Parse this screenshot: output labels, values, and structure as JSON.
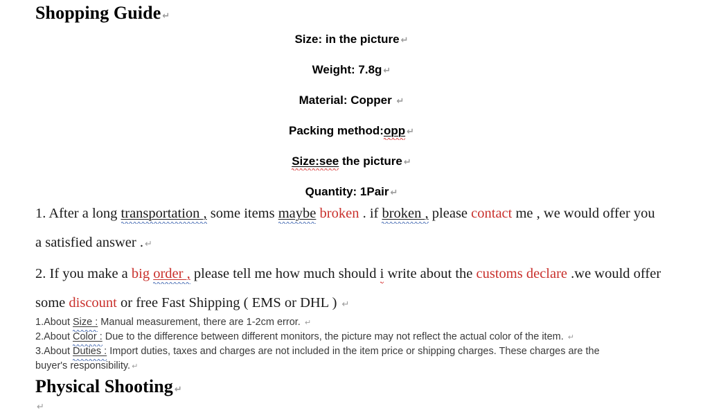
{
  "document": {
    "heading_shopping_guide": "Shopping Guide",
    "heading_physical_shooting": "Physical Shooting",
    "pilcrow_glyph": "↵",
    "accent_red": "#c9302c",
    "spellcheck_red": "#d83b3b",
    "grammarcheck_blue": "#4a6fb5",
    "specs": [
      {
        "label": "Size:",
        "value": " in the picture"
      },
      {
        "label": "Weight:",
        "value": " 7.8g"
      },
      {
        "label": "Material:",
        "value": " Copper "
      },
      {
        "label": "Packing method:",
        "value": " opp"
      },
      {
        "label": "Size:see",
        "value": " the picture"
      },
      {
        "label": "Quantity:",
        "value": " 1Pair"
      }
    ],
    "spec_flat": [
      "Size: in the picture",
      "Weight: 7.8g",
      "Material: Copper ",
      "Packing method: opp",
      "Size:see the picture",
      "Quantity: 1Pair"
    ],
    "paragraph_1": {
      "number": "1.",
      "seg_a": " After a long ",
      "seg_transportation": "transportation ,",
      "seg_b": " some items ",
      "seg_maybe": "maybe",
      "seg_c": " ",
      "seg_broken1": "broken",
      "seg_d": " . if ",
      "seg_broken2": "broken ,",
      "seg_e": " please ",
      "seg_contact": "contact",
      "seg_f": " me , we would offer you",
      "line2": "a satisfied answer ."
    },
    "paragraph_2": {
      "number": "2.",
      "seg_a": " If you make a ",
      "seg_big": "big ",
      "seg_order": "order ,",
      "seg_b": " please tell me how much should ",
      "seg_i": "i",
      "seg_c": " write about the ",
      "seg_customs": "customs declare",
      "seg_d": " .we would offer",
      "line2_a": "some ",
      "line2_discount": "discount",
      "line2_b": " or free Fast Shipping ( EMS or DHL ) "
    },
    "notes": [
      {
        "number": "1.About ",
        "term": "Size :",
        "text": " Manual measurement, there are 1-2cm error.",
        "trailing_spaces": "     "
      },
      {
        "number": "2.About ",
        "term": "Color :",
        "text": " Due to the difference between different monitors, the picture may not reflect the actual color of the item. ",
        "trailing_spaces": " "
      },
      {
        "number": "3.About ",
        "term": "Duties :",
        "text": " Import duties, taxes and charges are not included in the item price or shipping charges. These charges are the",
        "continuation": "buyer's responsibility."
      }
    ]
  }
}
